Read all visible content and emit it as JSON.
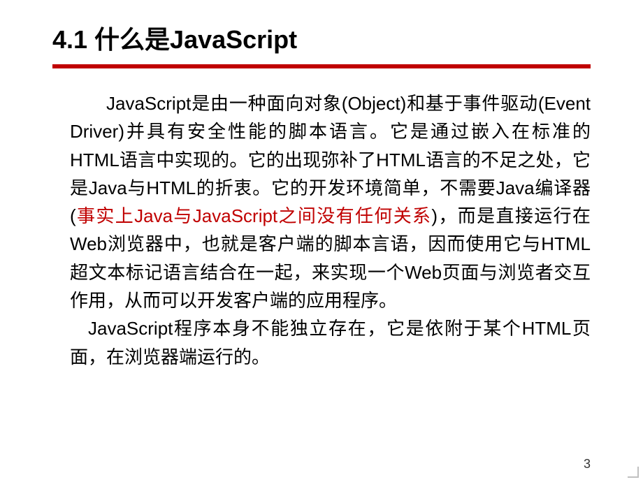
{
  "title": "4.1  什么是JavaScript",
  "para1_part1": "JavaScript是由一种面向对象(Object)和基于事件驱动(Event Driver)并具有安全性能的脚本语言。它是通过嵌入在标准的HTML语言中实现的。它的出现弥补了HTML语言的不足之处，它是Java与HTML的折衷。它的开发环境简单，不需要Java编译器(",
  "para1_highlight": "事实上Java与JavaScript之间没有任何关系",
  "para1_part2": ")，而是直接运行在Web浏览器中，也就是客户端的脚本言语，因而使用它与HTML超文本标记语言结合在一起，来实现一个Web页面与浏览者交互作用，从而可以开发客户端的应用程序。",
  "para2": "JavaScript程序本身不能独立存在，它是依附于某个HTML页面，在浏览器端运行的。",
  "page_number": "3"
}
